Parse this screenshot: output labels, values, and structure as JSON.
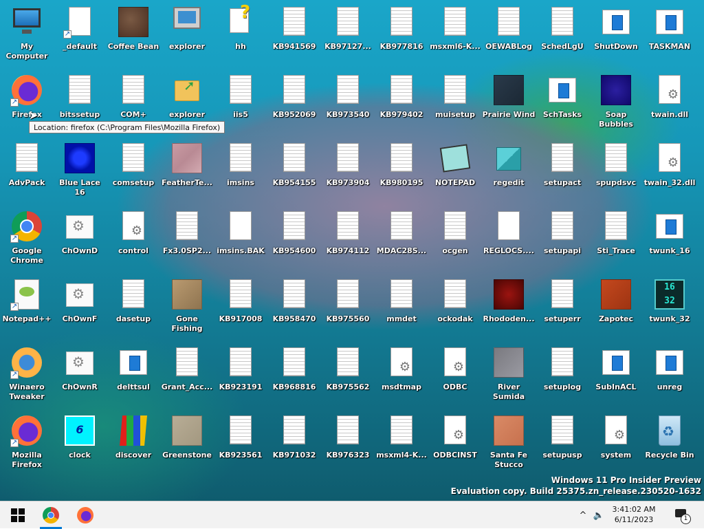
{
  "desktop": {
    "columns": [
      [
        {
          "label": "My Computer",
          "icon": "monitor-icon"
        },
        {
          "label": "Firefox",
          "icon": "firefox-icon",
          "shortcut": true
        },
        {
          "label": "AdvPack",
          "icon": "text-document-icon"
        },
        {
          "label": "Google Chrome",
          "icon": "chrome-icon",
          "shortcut": true
        },
        {
          "label": "Notepad++",
          "icon": "notepadpp-icon",
          "shortcut": true
        },
        {
          "label": "Winaero Tweaker",
          "icon": "winaero-icon",
          "shortcut": true
        },
        {
          "label": "Mozilla Firefox",
          "icon": "firefox-icon",
          "shortcut": true
        }
      ],
      [
        {
          "label": "_default",
          "icon": "blank-document-icon",
          "shortcut": true
        },
        {
          "label": "bitssetup",
          "icon": "text-document-icon"
        },
        {
          "label": "Blue Lace 16",
          "icon": "bmp-bluelace-icon"
        },
        {
          "label": "ChOwnD",
          "icon": "gears-window-icon"
        },
        {
          "label": "ChOwnF",
          "icon": "gears-window-icon"
        },
        {
          "label": "ChOwnR",
          "icon": "gears-window-icon"
        },
        {
          "label": "clock",
          "icon": "clock-icon"
        }
      ],
      [
        {
          "label": "Coffee Bean",
          "icon": "bmp-coffee-icon"
        },
        {
          "label": "COM+",
          "icon": "text-document-icon"
        },
        {
          "label": "comsetup",
          "icon": "text-document-icon"
        },
        {
          "label": "control",
          "icon": "gear-document-icon"
        },
        {
          "label": "dasetup",
          "icon": "text-document-icon"
        },
        {
          "label": "delttsul",
          "icon": "window-app-icon"
        },
        {
          "label": "discover",
          "icon": "discover-icon"
        }
      ],
      [
        {
          "label": "explorer",
          "icon": "old-computer-icon"
        },
        {
          "label": "explorer",
          "icon": "folder-icon"
        },
        {
          "label": "FeatherTe...",
          "icon": "bmp-feather-icon"
        },
        {
          "label": "Fx3.0SP2...",
          "icon": "text-document-icon"
        },
        {
          "label": "Gone Fishing",
          "icon": "bmp-fishing-icon"
        },
        {
          "label": "Grant_Acc...",
          "icon": "text-document-icon"
        },
        {
          "label": "Greenstone",
          "icon": "bmp-greenstone-icon"
        }
      ],
      [
        {
          "label": "hh",
          "icon": "help-icon"
        },
        {
          "label": "iis5",
          "icon": "text-document-icon"
        },
        {
          "label": "imsins",
          "icon": "text-document-icon"
        },
        {
          "label": "imsins.BAK",
          "icon": "blank-document-icon"
        },
        {
          "label": "KB917008",
          "icon": "text-document-icon"
        },
        {
          "label": "KB923191",
          "icon": "text-document-icon"
        },
        {
          "label": "KB923561",
          "icon": "text-document-icon"
        }
      ],
      [
        {
          "label": "KB941569",
          "icon": "text-document-icon"
        },
        {
          "label": "KB952069",
          "icon": "text-document-icon"
        },
        {
          "label": "KB954155",
          "icon": "text-document-icon"
        },
        {
          "label": "KB954600",
          "icon": "text-document-icon"
        },
        {
          "label": "KB958470",
          "icon": "text-document-icon"
        },
        {
          "label": "KB968816",
          "icon": "text-document-icon"
        },
        {
          "label": "KB971032",
          "icon": "text-document-icon"
        }
      ],
      [
        {
          "label": "KB97127...",
          "icon": "text-document-icon"
        },
        {
          "label": "KB973540",
          "icon": "text-document-icon"
        },
        {
          "label": "KB973904",
          "icon": "text-document-icon"
        },
        {
          "label": "KB974112",
          "icon": "text-document-icon"
        },
        {
          "label": "KB975560",
          "icon": "text-document-icon"
        },
        {
          "label": "KB975562",
          "icon": "text-document-icon"
        },
        {
          "label": "KB976323",
          "icon": "text-document-icon"
        }
      ],
      [
        {
          "label": "KB977816",
          "icon": "text-document-icon"
        },
        {
          "label": "KB979402",
          "icon": "text-document-icon"
        },
        {
          "label": "KB980195",
          "icon": "text-document-icon"
        },
        {
          "label": "MDAC28S...",
          "icon": "text-document-icon"
        },
        {
          "label": "mmdet",
          "icon": "text-document-icon"
        },
        {
          "label": "msdtmap",
          "icon": "gear-document-icon"
        },
        {
          "label": "msxml4-K...",
          "icon": "text-document-icon"
        }
      ],
      [
        {
          "label": "msxml6-K...",
          "icon": "text-document-icon"
        },
        {
          "label": "muisetup",
          "icon": "text-document-icon"
        },
        {
          "label": "NOTEPAD",
          "icon": "notepad-icon"
        },
        {
          "label": "ocgen",
          "icon": "text-document-icon"
        },
        {
          "label": "ockodak",
          "icon": "text-document-icon"
        },
        {
          "label": "ODBC",
          "icon": "gear-document-icon"
        },
        {
          "label": "ODBCINST",
          "icon": "gear-document-icon"
        }
      ],
      [
        {
          "label": "OEWABLog",
          "icon": "text-document-icon"
        },
        {
          "label": "Prairie Wind",
          "icon": "bmp-prairie-icon"
        },
        {
          "label": "regedit",
          "icon": "regedit-icon"
        },
        {
          "label": "REGLOCS....",
          "icon": "blank-document-icon"
        },
        {
          "label": "Rhododen...",
          "icon": "bmp-rhododendron-icon"
        },
        {
          "label": "River Sumida",
          "icon": "bmp-river-icon"
        },
        {
          "label": "Santa Fe Stucco",
          "icon": "bmp-stucco-icon"
        }
      ],
      [
        {
          "label": "SchedLgU",
          "icon": "text-document-icon"
        },
        {
          "label": "SchTasks",
          "icon": "window-app-icon"
        },
        {
          "label": "setupact",
          "icon": "text-document-icon"
        },
        {
          "label": "setupapi",
          "icon": "text-document-icon"
        },
        {
          "label": "setuperr",
          "icon": "text-document-icon"
        },
        {
          "label": "setuplog",
          "icon": "text-document-icon"
        },
        {
          "label": "setupusp",
          "icon": "text-document-icon"
        }
      ],
      [
        {
          "label": "ShutDown",
          "icon": "window-app-icon"
        },
        {
          "label": "Soap Bubbles",
          "icon": "bmp-soap-icon"
        },
        {
          "label": "spupdsvc",
          "icon": "text-document-icon"
        },
        {
          "label": "Sti_Trace",
          "icon": "text-document-icon"
        },
        {
          "label": "Zapotec",
          "icon": "bmp-zapotec-icon"
        },
        {
          "label": "SubInACL",
          "icon": "window-app-icon"
        },
        {
          "label": "system",
          "icon": "gear-document-icon"
        }
      ],
      [
        {
          "label": "TASKMAN",
          "icon": "window-app-icon"
        },
        {
          "label": "twain.dll",
          "icon": "gear-document-icon"
        },
        {
          "label": "twain_32.dll",
          "icon": "gear-document-icon"
        },
        {
          "label": "twunk_16",
          "icon": "window-app-icon"
        },
        {
          "label": "twunk_32",
          "icon": "twunk32-icon"
        },
        {
          "label": "unreg",
          "icon": "window-app-icon"
        },
        {
          "label": "Recycle Bin",
          "icon": "recycle-bin-icon"
        }
      ]
    ],
    "tooltip": "Location: firefox (C:\\Program Files\\Mozilla Firefox)",
    "watermark_line1": "Windows 11 Pro Insider Preview",
    "watermark_line2": "Evaluation copy. Build 25375.zn_release.230520-1632",
    "clock_glyph_text": "6",
    "twunk32_glyph_text": "16\n32"
  },
  "taskbar": {
    "start": "start-button",
    "pinned": [
      {
        "name": "Google Chrome",
        "icon": "chrome-icon",
        "active": true
      },
      {
        "name": "Firefox",
        "icon": "firefox-icon",
        "active": false
      }
    ],
    "time": "3:41:02 AM",
    "date": "6/11/2023",
    "tray_chevron": "^",
    "notification_count": "1"
  },
  "colors": {
    "taskbar_bg": "#f2f2f2",
    "active_indicator": "#0078d4",
    "desktop_label": "#ffffff"
  }
}
